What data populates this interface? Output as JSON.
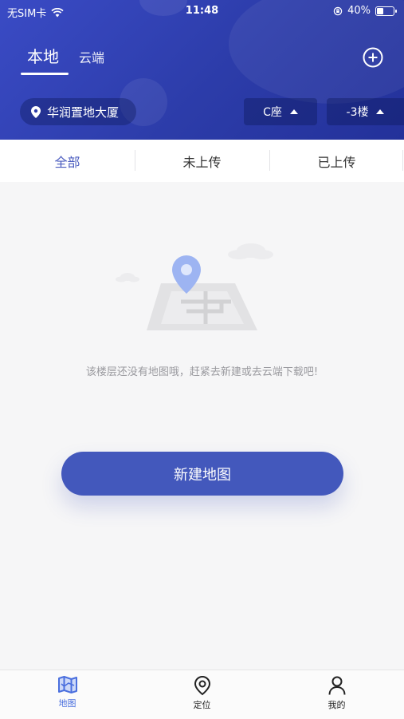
{
  "status_bar": {
    "carrier": "无SIM卡",
    "time": "11:48",
    "battery": "40%",
    "battery_level": 0.4
  },
  "header": {
    "tabs": [
      {
        "label": "本地",
        "active": true
      },
      {
        "label": "云端",
        "active": false
      }
    ],
    "add_icon": "plus-circle-icon",
    "location": "华润置地大厦",
    "building": "C座",
    "floor": "-3楼"
  },
  "filter_tabs": [
    {
      "label": "全部",
      "active": true
    },
    {
      "label": "未上传",
      "active": false
    },
    {
      "label": "已上传",
      "active": false
    }
  ],
  "empty_state": {
    "message": "该楼层还没有地图哦，赶紧去新建或去云端下载吧!",
    "illustration": "map-with-pin-icon"
  },
  "new_map_button": "新建地图",
  "tab_bar": [
    {
      "label": "地图",
      "icon": "map-icon",
      "active": true
    },
    {
      "label": "定位",
      "icon": "location-pin-icon",
      "active": false
    },
    {
      "label": "我的",
      "icon": "user-icon",
      "active": false
    }
  ],
  "colors": {
    "header_blue": "#3a4bc5",
    "accent": "#4358bc",
    "active_tab": "#4a6fde",
    "background": "#f6f6f7"
  }
}
